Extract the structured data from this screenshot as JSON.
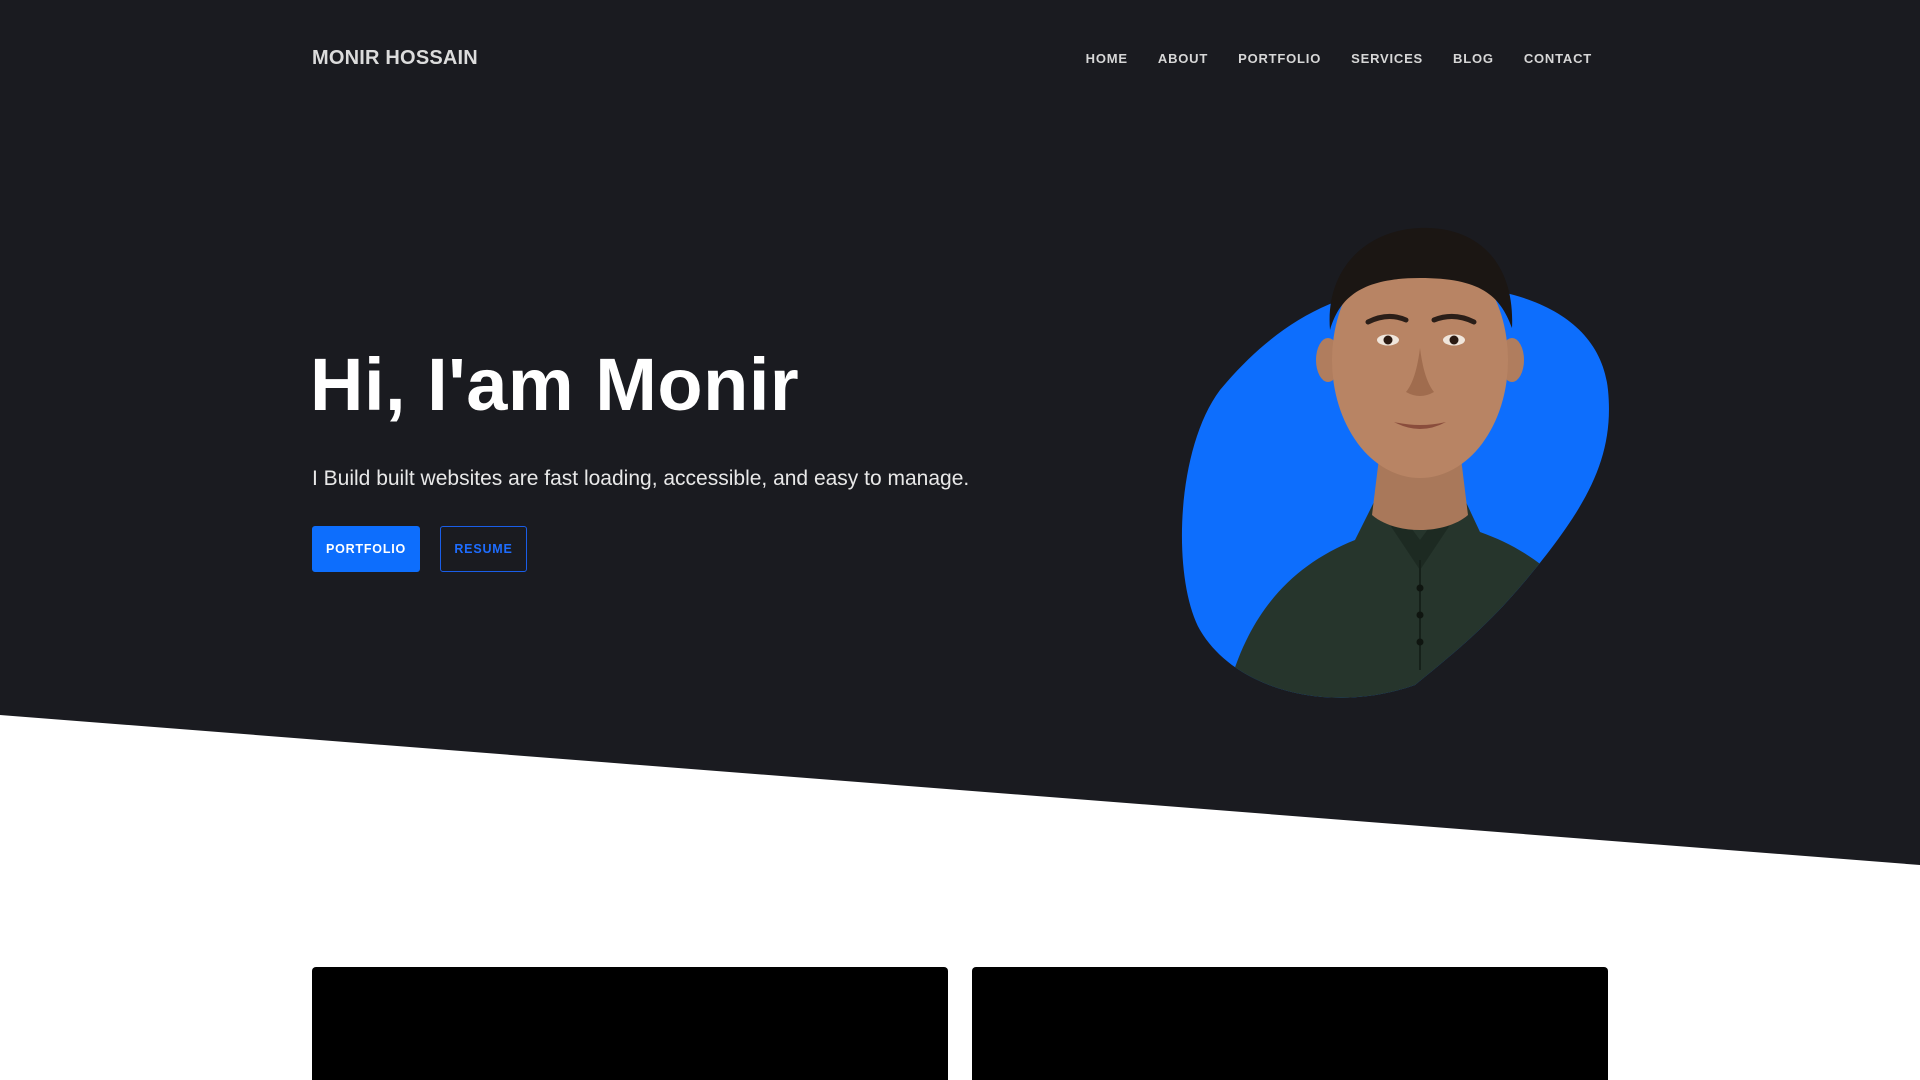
{
  "header": {
    "brand": "MONIR HOSSAIN",
    "nav": [
      "HOME",
      "ABOUT",
      "PORTFOLIO",
      "SERVICES",
      "BLOG",
      "CONTACT"
    ]
  },
  "hero": {
    "title": "Hi, I'am Monir",
    "subtitle": "I Build built websites are fast loading, accessible, and easy to manage.",
    "primary_button": "PORTFOLIO",
    "secondary_button": "RESUME"
  },
  "colors": {
    "hero_background": "#1a1b20",
    "accent_blue": "#0d6efd",
    "card_background": "#000000"
  },
  "icons": {
    "portrait": "profile-photo-man"
  }
}
